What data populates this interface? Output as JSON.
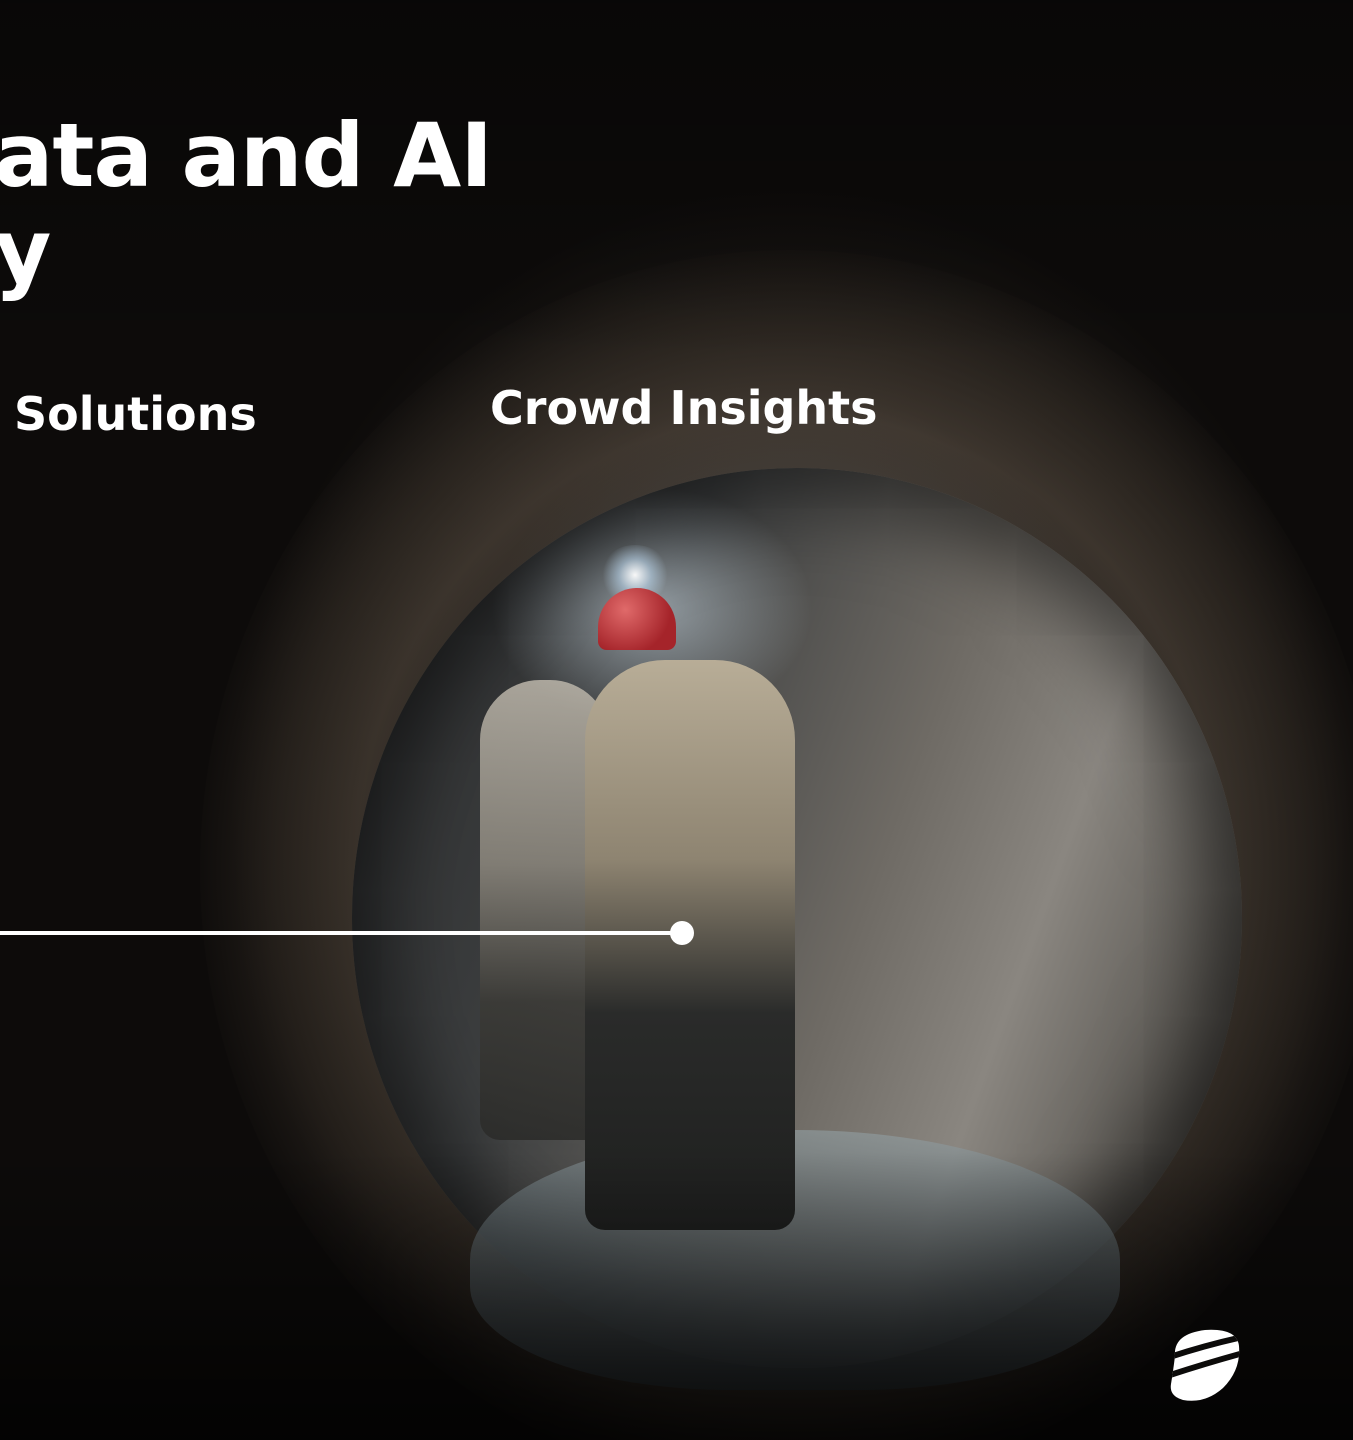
{
  "headline": {
    "line1": "ata and AI",
    "line2": "y"
  },
  "labels": {
    "solutions": "Solutions",
    "crowd_insights": "Crowd Insights"
  },
  "icons": {
    "logo": "brand-globe-logo",
    "connector": "connector-dot"
  },
  "colors": {
    "text": "#ffffff",
    "background": "#0c0b0a"
  }
}
